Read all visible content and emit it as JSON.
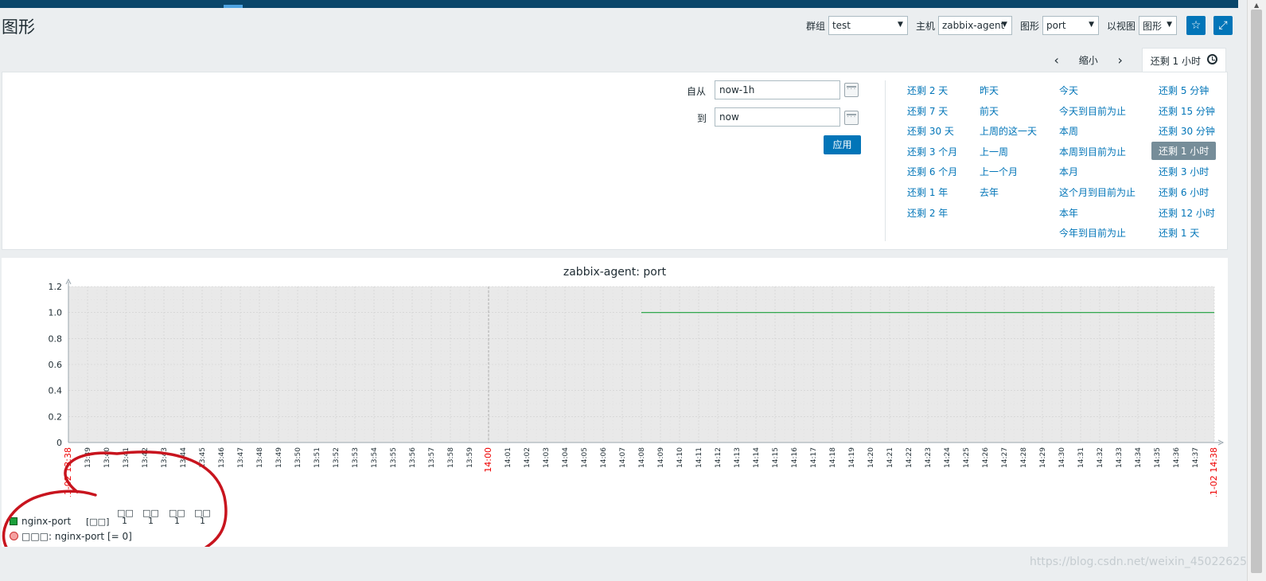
{
  "page": {
    "title": "图形"
  },
  "filters": {
    "group_label": "群组",
    "group_value": "test",
    "host_label": "主机",
    "host_value": "zabbix-agent",
    "graph_label": "图形",
    "graph_value": "port",
    "view_label": "以视图",
    "view_value": "图形"
  },
  "timebar": {
    "zoom_out": "缩小",
    "active_tab": "还剩 1 小时"
  },
  "time_range": {
    "from_label": "自从",
    "from_value": "now-1h",
    "to_label": "到",
    "to_value": "now",
    "apply": "应用"
  },
  "quick_ranges": {
    "col1": [
      "还剩 2 天",
      "还剩 7 天",
      "还剩 30 天",
      "还剩 3 个月",
      "还剩 6 个月",
      "还剩 1 年",
      "还剩 2 年"
    ],
    "col2": [
      "昨天",
      "前天",
      "上周的这一天",
      "上一周",
      "上一个月",
      "去年"
    ],
    "col3": [
      "今天",
      "今天到目前为止",
      "本周",
      "本周到目前为止",
      "本月",
      "这个月到目前为止",
      "本年",
      "今年到目前为止"
    ],
    "col4": [
      "还剩 5 分钟",
      "还剩 15 分钟",
      "还剩 30 分钟",
      "还剩 1 小时",
      "还剩 3 小时",
      "还剩 6 小时",
      "还剩 12 小时",
      "还剩 1 天"
    ],
    "selected": "还剩 1 小时"
  },
  "chart_data": {
    "type": "line",
    "title": "zabbix-agent: port",
    "ylim": [
      0,
      1.2
    ],
    "y_ticks": [
      "0",
      "0.2",
      "0.4",
      "0.6",
      "0.8",
      "1.0",
      "1.2"
    ],
    "x_start_label": "11-02 13:38",
    "x_end_label": "11-02 14:38",
    "x_minutes": [
      "13:38",
      "13:39",
      "13:40",
      "13:41",
      "13:42",
      "13:43",
      "13:44",
      "13:45",
      "13:46",
      "13:47",
      "13:48",
      "13:49",
      "13:50",
      "13:51",
      "13:52",
      "13:53",
      "13:54",
      "13:55",
      "13:56",
      "13:57",
      "13:58",
      "13:59",
      "14:00",
      "14:01",
      "14:02",
      "14:03",
      "14:04",
      "14:05",
      "14:06",
      "14:07",
      "14:08",
      "14:09",
      "14:10",
      "14:11",
      "14:12",
      "14:13",
      "14:14",
      "14:15",
      "14:16",
      "14:17",
      "14:18",
      "14:19",
      "14:20",
      "14:21",
      "14:22",
      "14:23",
      "14:24",
      "14:25",
      "14:26",
      "14:27",
      "14:28",
      "14:29",
      "14:30",
      "14:31",
      "14:32",
      "14:33",
      "14:34",
      "14:35",
      "14:36",
      "14:37",
      "14:38"
    ],
    "highlight_labels": [
      "11-02 13:38",
      "14:00",
      "11-02 14:38"
    ],
    "grid": true,
    "series": [
      {
        "name": "nginx-port",
        "color": "#1a9f3a",
        "x": [
          "14:08",
          "14:38"
        ],
        "values": [
          1,
          1
        ]
      }
    ],
    "legend": {
      "unit_label": "[□□]",
      "stat_headers": [
        "□□",
        "□□",
        "□□",
        "□□"
      ],
      "stat_values": [
        "1",
        "1",
        "1",
        "1"
      ],
      "trigger_label": "□□□: nginx-port",
      "trigger_expr": "[= 0]"
    }
  },
  "watermark": "https://blog.csdn.net/weixin_45022625"
}
